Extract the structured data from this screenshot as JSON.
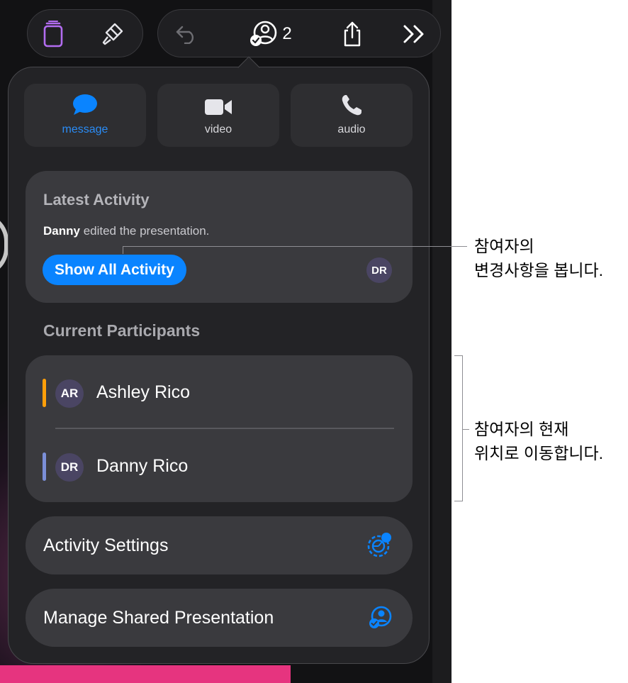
{
  "toolbar": {
    "collaborator_count": "2",
    "icons": [
      "documents-icon",
      "paintbrush-icon",
      "undo-icon",
      "collaboration-icon",
      "share-icon",
      "more-icon"
    ]
  },
  "communication": {
    "message_label": "message",
    "video_label": "video",
    "audio_label": "audio"
  },
  "latest_activity": {
    "title": "Latest Activity",
    "actor": "Danny",
    "action": " edited the presentation.",
    "button_label": "Show All Activity",
    "avatar_initials": "DR"
  },
  "participants": {
    "title": "Current Participants",
    "items": [
      {
        "initials": "AR",
        "name": "Ashley Rico",
        "color": "#ff9f0a"
      },
      {
        "initials": "DR",
        "name": "Danny Rico",
        "color": "#7b8fd8"
      }
    ]
  },
  "actions": {
    "activity_settings_label": "Activity Settings",
    "manage_label": "Manage Shared Presentation"
  },
  "callouts": {
    "activity_line1": "참여자의",
    "activity_line2": "변경사항을 봅니다.",
    "participants_line1": "참여자의 현재",
    "participants_line2": "위치로 이동합니다."
  },
  "colors": {
    "accent": "#0a84ff",
    "card": "#3a3a3e",
    "popover": "#232326"
  }
}
